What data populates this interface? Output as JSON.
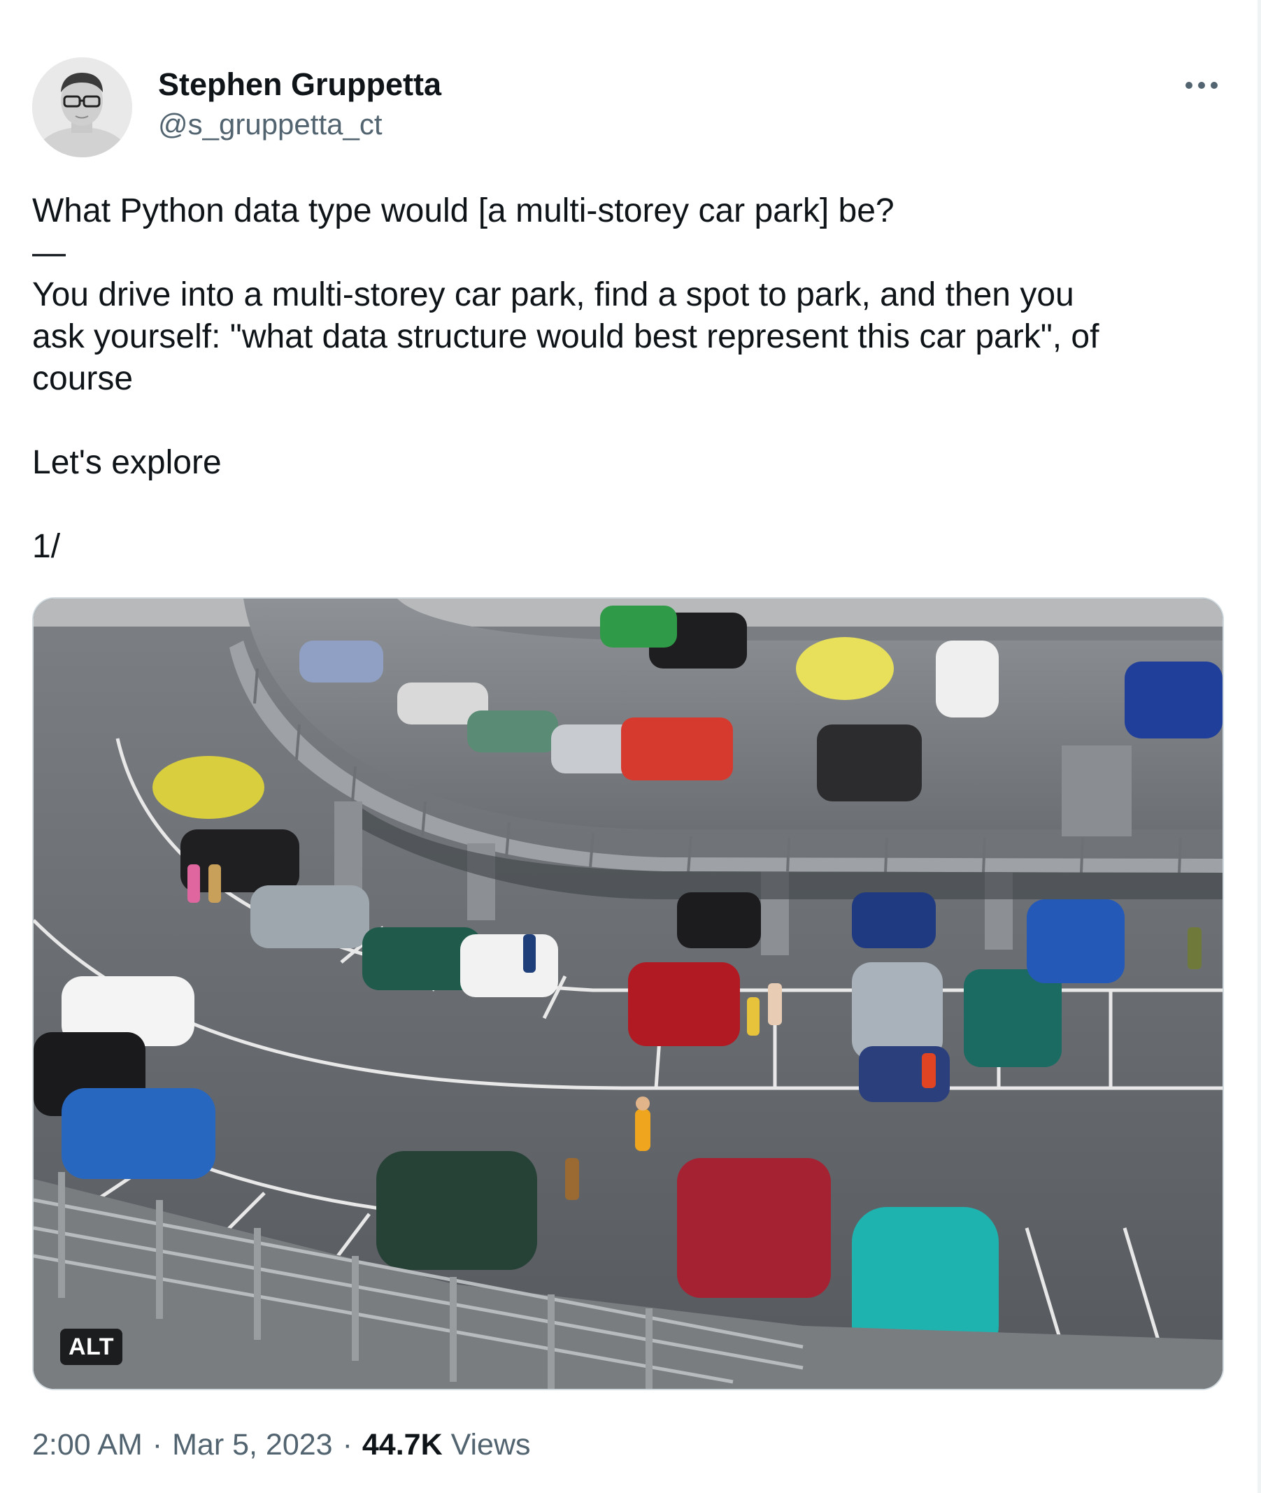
{
  "author": {
    "display_name": "Stephen Gruppetta",
    "handle": "@s_gruppetta_ct",
    "avatar_icon": "profile-photo"
  },
  "more_icon": "ellipsis-icon",
  "tweet": {
    "title_line": "What Python data type would [a multi-storey car park] be?",
    "divider": "—",
    "body_lines": [
      "You drive into a multi-storey car park, find a spot to park, and then you",
      "ask yourself: \"what data structure would best represent this car park\", of",
      "course"
    ],
    "explore": "Let's explore",
    "thread_marker": "1/"
  },
  "media": {
    "alt_label": "ALT",
    "subject": "model-car-park-photo"
  },
  "meta": {
    "time": "2:00 AM",
    "separator": "·",
    "date": "Mar 5, 2023",
    "views_count": "44.7K",
    "views_label": "Views"
  },
  "colors": {
    "text_primary": "#0f1419",
    "text_secondary": "#536471",
    "border": "#cfd9de"
  }
}
